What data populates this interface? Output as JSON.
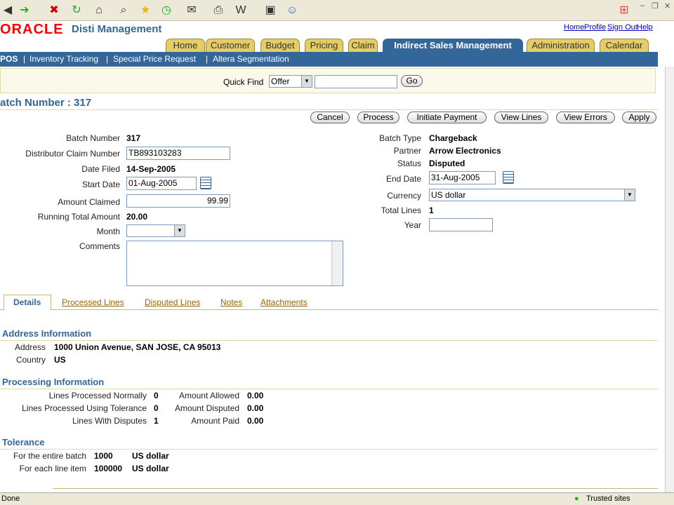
{
  "browser": {
    "status": "Done",
    "zone": "Trusted sites"
  },
  "header": {
    "logo": "ORACLE",
    "app_name": "Disti Management",
    "links": [
      "Home",
      "Profile",
      "Sign Out",
      "Help"
    ]
  },
  "tabs": [
    "Home",
    "Customer",
    "Budget",
    "Pricing",
    "Claim",
    "Indirect Sales Management",
    "Administration",
    "Calendar"
  ],
  "subnav": [
    "POS",
    "Inventory Tracking",
    "Special Price Request",
    "Altera Segmentation"
  ],
  "quickfind": {
    "label": "Quick Find",
    "selected": "Offer",
    "go": "Go"
  },
  "page": {
    "title": "atch Number : 317"
  },
  "buttons": [
    "Cancel",
    "Process",
    "Initiate Payment",
    "View Lines",
    "View Errors",
    "Apply"
  ],
  "form": {
    "batch_number_label": "Batch Number",
    "batch_number": "317",
    "dcn_label": "Distributor Claim Number",
    "dcn": "TB893103283",
    "date_filed_label": "Date Filed",
    "date_filed": "14-Sep-2005",
    "start_date_label": "Start Date",
    "start_date": "01-Aug-2005",
    "amount_claimed_label": "Amount Claimed",
    "amount_claimed": "99.99",
    "rta_label": "Running Total Amount",
    "rta": "20.00",
    "month_label": "Month",
    "comments_label": "Comments",
    "batch_type_label": "Batch Type",
    "batch_type": "Chargeback",
    "partner_label": "Partner",
    "partner": "Arrow Electronics",
    "status_label": "Status",
    "status": "Disputed",
    "end_date_label": "End Date",
    "end_date": "31-Aug-2005",
    "currency_label": "Currency",
    "currency": "US dollar",
    "total_lines_label": "Total Lines",
    "total_lines": "1",
    "year_label": "Year"
  },
  "subtabs": [
    "Details",
    "Processed Lines",
    "Disputed Lines",
    "Notes",
    "Attachments"
  ],
  "address": {
    "title": "Address Information",
    "address_label": "Address",
    "address": "1000 Union Avenue, SAN JOSE, CA 95013",
    "country_label": "Country",
    "country": "US"
  },
  "processing": {
    "title": "Processing Information",
    "rows": [
      [
        "Lines Processed Normally",
        "0",
        "Amount Allowed",
        "0.00"
      ],
      [
        "Lines Processed Using Tolerance",
        "0",
        "Amount Disputed",
        "0.00"
      ],
      [
        "Lines With Disputes",
        "1",
        "Amount Paid",
        "0.00"
      ]
    ]
  },
  "tolerance": {
    "title": "Tolerance",
    "rows": [
      [
        "For the entire batch",
        "1000",
        "US dollar"
      ],
      [
        "For each line item",
        "100000",
        "US dollar"
      ]
    ]
  }
}
